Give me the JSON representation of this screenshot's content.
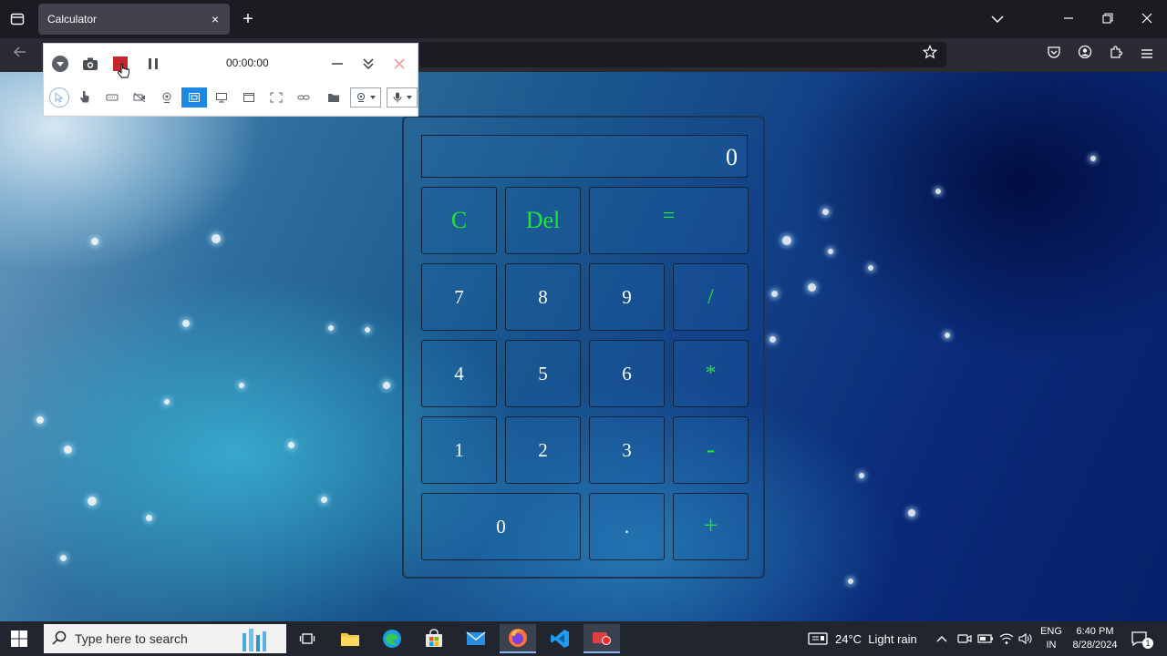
{
  "browser": {
    "tab_title": "Calculator",
    "tab_close": "×",
    "new_tab": "+"
  },
  "recorder": {
    "timer": "00:00:00"
  },
  "calculator": {
    "display": "0",
    "keys": {
      "clear": "C",
      "delete": "Del",
      "equals": "=",
      "seven": "7",
      "eight": "8",
      "nine": "9",
      "divide": "/",
      "four": "4",
      "five": "5",
      "six": "6",
      "multiply": "*",
      "one": "1",
      "two": "2",
      "three": "3",
      "minus": "-",
      "zero": "0",
      "dot": ".",
      "plus": "+"
    },
    "colors": {
      "operator": "#22e33a",
      "digit": "#ffffff"
    }
  },
  "taskbar": {
    "search_placeholder": "Type here to search",
    "weather": "24°C  Light rain",
    "lang_top": "ENG",
    "lang_bottom": "IN",
    "time": "6:40 PM",
    "date": "8/28/2024",
    "notification_count": "1"
  }
}
